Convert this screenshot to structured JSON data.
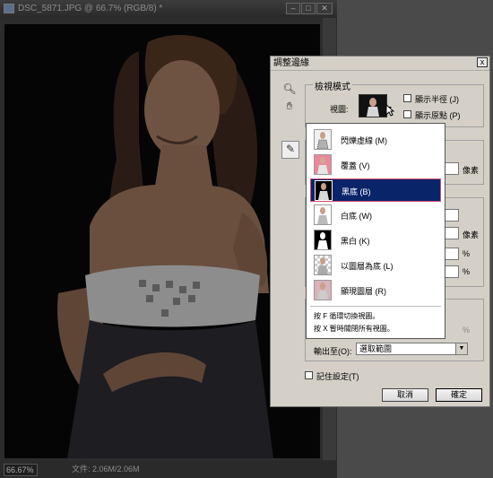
{
  "document": {
    "title": "DSC_5871.JPG @ 66.7% (RGB/8) *",
    "zoom": "66.67%",
    "file_size": "文件: 2.06M/2.06M"
  },
  "dialog": {
    "title": "調整邊緣",
    "close": "x",
    "view_mode": {
      "legend": "檢視模式",
      "view_label": "視圖:",
      "show_radius": "顯示半徑 (J)",
      "show_original": "顯示原點 (P)"
    },
    "units": [
      "像素",
      "像素",
      "%",
      "%",
      "%"
    ],
    "output_label": "輸出至(O):",
    "output_value": "選取範圍",
    "remember": "記住設定(T)",
    "cancel": "取消",
    "ok": "確定"
  },
  "view_menu": {
    "items": [
      {
        "label": "閃爍虛線 (M)",
        "selected": false
      },
      {
        "label": "覆蓋 (V)",
        "selected": false
      },
      {
        "label": "黑底 (B)",
        "selected": true
      },
      {
        "label": "白底 (W)",
        "selected": false
      },
      {
        "label": "黑白 (K)",
        "selected": false
      },
      {
        "label": "以圖層為底 (L)",
        "selected": false
      },
      {
        "label": "顯現圖層 (R)",
        "selected": false
      }
    ],
    "hint1": "按 F 循環切換視圖。",
    "hint2": "按 X 暫時關閉所有視圖。"
  },
  "colors": {
    "selection_bg": "#0a246a",
    "selection_border": "#d05070",
    "dialog_bg": "#d4d0c8",
    "workspace_bg": "#4a4a4a"
  }
}
